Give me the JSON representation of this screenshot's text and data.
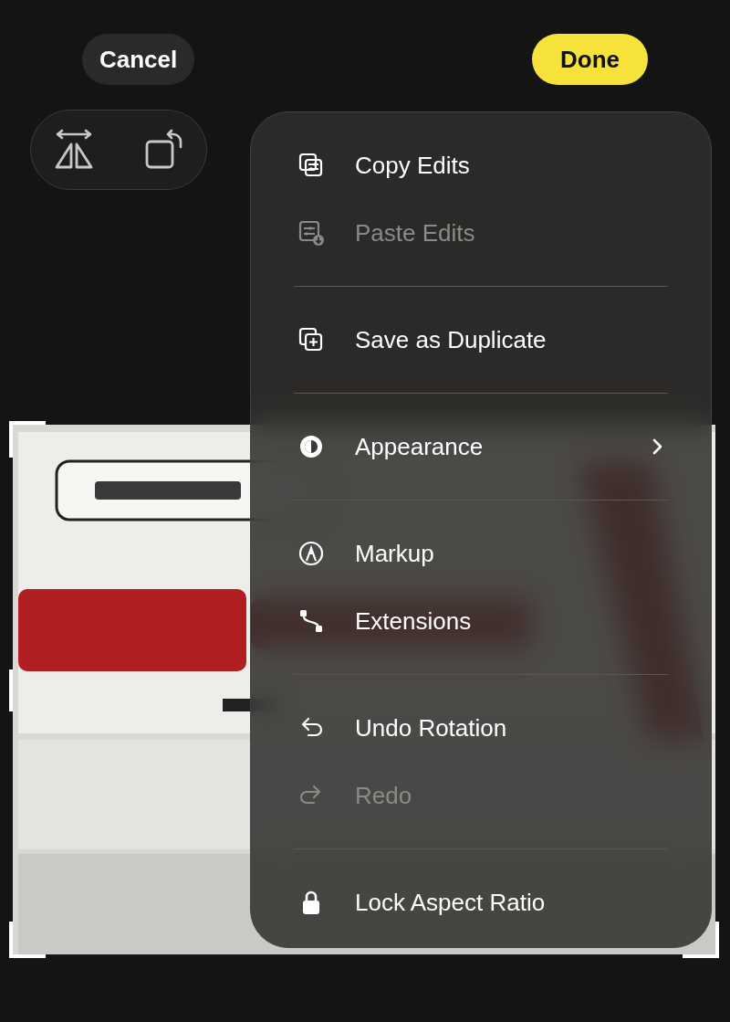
{
  "top_bar": {
    "cancel": "Cancel",
    "done": "Done"
  },
  "menu": {
    "sections": [
      [
        {
          "label": "Copy Edits",
          "disabled": false,
          "submenu": false
        },
        {
          "label": "Paste Edits",
          "disabled": true,
          "submenu": false
        }
      ],
      [
        {
          "label": "Save as Duplicate",
          "disabled": false,
          "submenu": false
        }
      ],
      [
        {
          "label": "Appearance",
          "disabled": false,
          "submenu": true
        }
      ],
      [
        {
          "label": "Markup",
          "disabled": false,
          "submenu": false
        },
        {
          "label": "Extensions",
          "disabled": false,
          "submenu": false
        }
      ],
      [
        {
          "label": "Undo Rotation",
          "disabled": false,
          "submenu": false
        },
        {
          "label": "Redo",
          "disabled": true,
          "submenu": false
        }
      ],
      [
        {
          "label": "Lock Aspect Ratio",
          "disabled": false,
          "submenu": false
        }
      ]
    ]
  }
}
